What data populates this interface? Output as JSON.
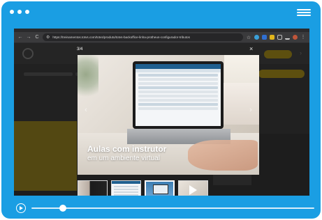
{
  "browser": {
    "url": "https://treinamentos.totvs.com/totvs/produto/totvs-backoffice-linha-protheus-configurador-tributos",
    "nav_back": "←",
    "nav_forward": "→",
    "nav_reload": "C"
  },
  "gallery": {
    "counter": "3/4",
    "close": "×",
    "prev": "‹",
    "next": "›",
    "slide_title": "Aulas com instrutor",
    "slide_subtitle": "em um ambiente virtual",
    "thumbnails": 4,
    "active_thumbnail": 3
  },
  "player": {
    "progress": 0.11
  },
  "colors": {
    "frame": "#1a9ee3",
    "browser_bg": "#3b3b3d",
    "accent_yellow": "#8f7a18"
  }
}
